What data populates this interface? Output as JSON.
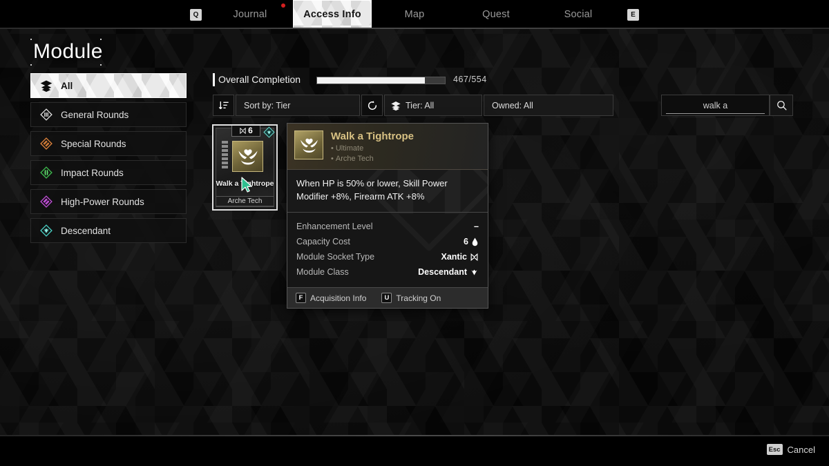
{
  "tabbar": {
    "left_key": "Q",
    "right_key": "E",
    "tabs": [
      {
        "label": "Journal",
        "active": false
      },
      {
        "label": "Access Info",
        "active": true
      },
      {
        "label": "Map",
        "active": false
      },
      {
        "label": "Quest",
        "active": false
      },
      {
        "label": "Social",
        "active": false
      }
    ]
  },
  "page": {
    "title": "Module"
  },
  "sidebar": {
    "items": [
      {
        "label": "All",
        "icon": "layers-icon",
        "color": "#ffffff",
        "active": true
      },
      {
        "label": "General Rounds",
        "icon": "general-rounds-icon",
        "color": "#e8e8e8",
        "active": false
      },
      {
        "label": "Special Rounds",
        "icon": "special-rounds-icon",
        "color": "#e2853c",
        "active": false
      },
      {
        "label": "Impact Rounds",
        "icon": "impact-rounds-icon",
        "color": "#3fbc4f",
        "active": false
      },
      {
        "label": "High-Power Rounds",
        "icon": "high-power-rounds-icon",
        "color": "#c04fd6",
        "active": false
      },
      {
        "label": "Descendant",
        "icon": "descendant-icon",
        "color": "#49cfc4",
        "active": false
      }
    ]
  },
  "completion": {
    "label": "Overall Completion",
    "count_text": "467/554",
    "current": 467,
    "total": 554,
    "percent": 84.3
  },
  "toolbar": {
    "sort_icon": "sort-descending-icon",
    "sort_label": "Sort by: Tier",
    "reset_icon": "refresh-icon",
    "tier_icon": "layers-icon",
    "tier_label": "Tier: All",
    "owned_label": "Owned: All",
    "search_value": "walk a",
    "search_placeholder": "Search",
    "search_icon": "search-icon"
  },
  "card": {
    "cost": "6",
    "socket_icon": "xantic-socket-icon",
    "class_badge_icon": "descendant-badge-icon",
    "art_icon": "winged-heart-icon",
    "name": "Walk a Tightrope",
    "footer": "Arche Tech"
  },
  "tooltip": {
    "thumb_icon": "winged-heart-icon",
    "name": "Walk a Tightrope",
    "tier": "Ultimate",
    "category": "Arche Tech",
    "bullet": "•",
    "description": "When HP is 50% or lower, Skill Power Modifier +8%, Firearm ATK +8%",
    "stats": [
      {
        "key": "Enhancement Level",
        "value": "–",
        "icon": ""
      },
      {
        "key": "Capacity Cost",
        "value": "6",
        "icon": "capacity-drop-icon"
      },
      {
        "key": "Module Socket Type",
        "value": "Xantic",
        "icon": "xantic-socket-icon"
      },
      {
        "key": "Module Class",
        "value": "Descendant",
        "icon": "descendant-class-icon"
      }
    ],
    "footer": [
      {
        "key": "F",
        "label": "Acquisition Info"
      },
      {
        "key": "U",
        "label": "Tracking On"
      }
    ]
  },
  "bottombar": {
    "cancel_key": "Esc",
    "cancel_label": "Cancel"
  },
  "colors": {
    "accent_gold": "#d8c183",
    "notification": "#d31f1f",
    "cursor": "#2fbf8f"
  }
}
